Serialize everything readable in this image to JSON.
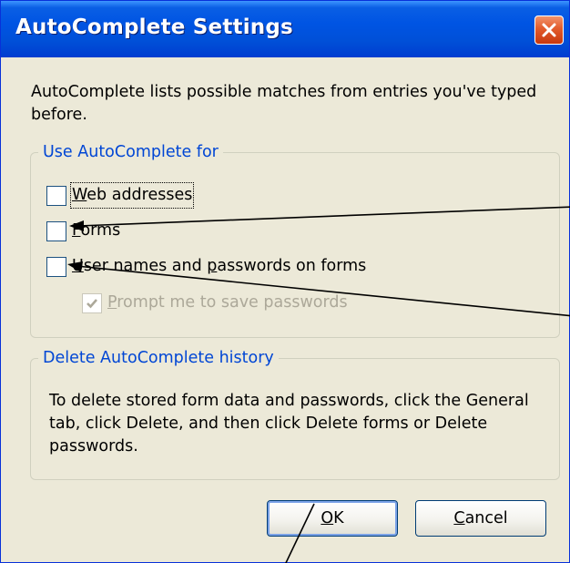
{
  "window": {
    "title": "AutoComplete Settings",
    "close_icon": "close-icon"
  },
  "intro": {
    "text": "AutoComplete lists possible matches from entries you've typed before."
  },
  "use_group": {
    "title": "Use AutoComplete for",
    "options": [
      {
        "label_prefix": "",
        "label_mnemonic": "W",
        "label_rest": "eb addresses",
        "checked": false,
        "enabled": true
      },
      {
        "label_prefix": "",
        "label_mnemonic": "F",
        "label_rest": "orms",
        "checked": false,
        "enabled": true
      },
      {
        "label_prefix": "",
        "label_mnemonic": "U",
        "label_rest": "ser names and ",
        "label_mnemonic2": "p",
        "label_rest2": "asswords on forms",
        "checked": false,
        "enabled": true
      },
      {
        "label_prefix": "",
        "label_mnemonic": "P",
        "label_rest": "rompt me to save passwords",
        "checked": true,
        "enabled": false
      }
    ]
  },
  "delete_group": {
    "title": "Delete AutoComplete history",
    "text": "To delete stored form data and passwords, click the General tab, click Delete, and then click Delete forms or Delete passwords."
  },
  "buttons": {
    "ok_mnemonic": "O",
    "ok_rest": "K",
    "cancel_mnemonic": "C",
    "cancel_rest": "ancel"
  },
  "colors": {
    "title_bar": "#0054e3",
    "group_title": "#0046d5",
    "dialog_bg": "#ece9d8"
  }
}
